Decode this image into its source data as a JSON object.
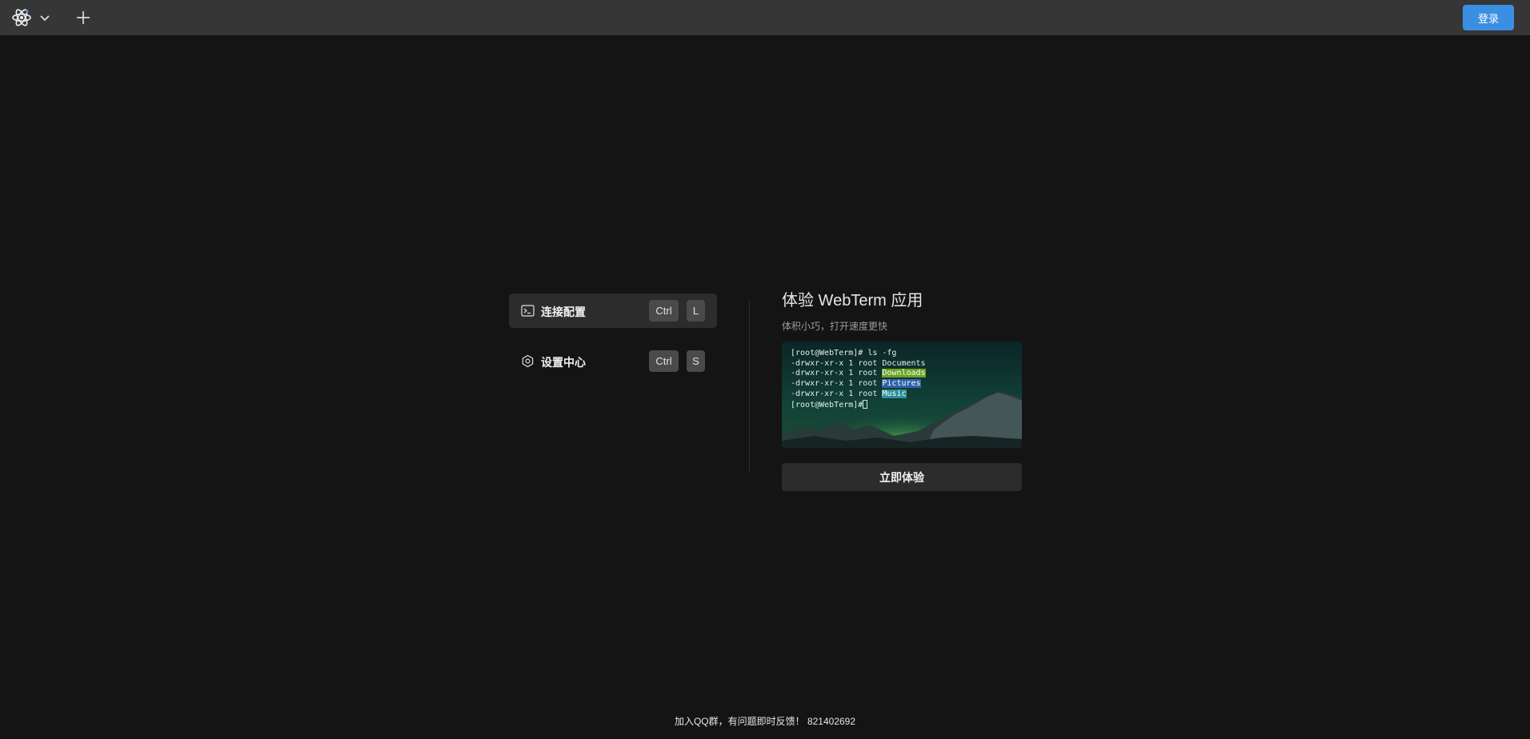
{
  "topbar": {
    "logo_icon": "atom-logo-icon",
    "menu_icon": "chevron-down-icon",
    "new_tab_icon": "plus-icon",
    "login_label": "登录",
    "accent_color": "#3b8fe3"
  },
  "menu": {
    "items": [
      {
        "label": "连接配置",
        "icon": "terminal-icon",
        "shortcut": [
          "Ctrl",
          "L"
        ],
        "active": true
      },
      {
        "label": "设置中心",
        "icon": "gear-icon",
        "shortcut": [
          "Ctrl",
          "S"
        ],
        "active": false
      }
    ]
  },
  "promo": {
    "title": "体验 WebTerm 应用",
    "subtitle": "体积小巧，打开速度更快",
    "terminal": {
      "prompt_line": "[root@WebTerm]# ls -fg",
      "rows": [
        {
          "perms": "-drwxr-xr-x 1 root ",
          "name": "Documents",
          "style": "plain"
        },
        {
          "perms": "-drwxr-xr-x 1 root ",
          "name": "Downloads",
          "style": "green"
        },
        {
          "perms": "-drwxr-xr-x 1 root ",
          "name": "Pictures",
          "style": "blue"
        },
        {
          "perms": "-drwxr-xr-x 1 root ",
          "name": "Music",
          "style": "teal"
        }
      ],
      "last_prompt": "[root@WebTerm]#"
    },
    "button_label": "立即体验"
  },
  "footer": {
    "text": "加入QQ群，有问题即时反馈！ 821402692"
  }
}
